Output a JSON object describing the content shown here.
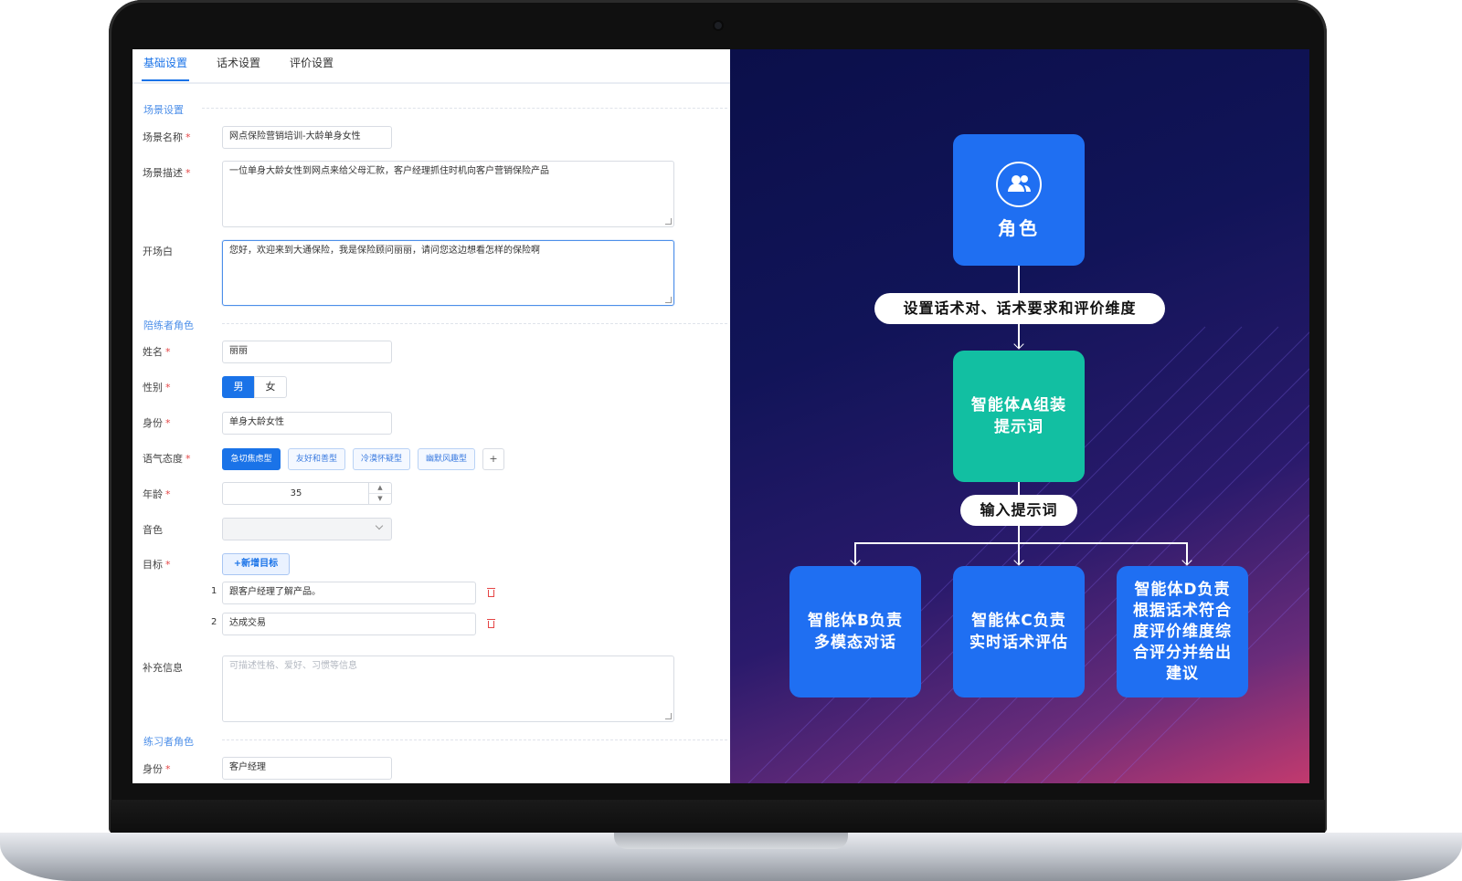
{
  "tabs": [
    {
      "label": "基础设置",
      "active": true
    },
    {
      "label": "话术设置",
      "active": false
    },
    {
      "label": "评价设置",
      "active": false
    }
  ],
  "sections": {
    "scene": "场景设置",
    "partner_role": "陪练者角色",
    "learner_role": "练习者角色"
  },
  "scene": {
    "name_label": "场景名称",
    "name_value": "网点保险营销培训-大龄单身女性",
    "desc_label": "场景描述",
    "desc_value": "一位单身大龄女性到网点来给父母汇款，客户经理抓住时机向客户营销保险产品",
    "opening_label": "开场白",
    "opening_value": "您好，欢迎来到大通保险，我是保险顾问丽丽，请问您这边想看怎样的保险啊"
  },
  "partner": {
    "name_label": "姓名",
    "name_value": "丽丽",
    "gender_label": "性别",
    "gender_options": [
      "男",
      "女"
    ],
    "gender_selected": "男",
    "identity_label": "身份",
    "identity_value": "单身大龄女性",
    "tone_label": "语气态度",
    "tones": [
      {
        "label": "急切焦虑型",
        "selected": true
      },
      {
        "label": "友好和善型",
        "selected": false
      },
      {
        "label": "冷漠怀疑型",
        "selected": false
      },
      {
        "label": "幽默风趣型",
        "selected": false
      }
    ],
    "tone_add": "+",
    "age_label": "年龄",
    "age_value": "35",
    "voice_label": "音色",
    "voice_value": "",
    "goal_label": "目标",
    "add_goal": "+新增目标",
    "goals": [
      {
        "index": "1",
        "text": "跟客户经理了解产品。"
      },
      {
        "index": "2",
        "text": "达成交易"
      }
    ],
    "extra_label": "补充信息",
    "extra_placeholder": "可描述性格、爱好、习惯等信息"
  },
  "learner": {
    "identity_label": "身份",
    "identity_value": "客户经理"
  },
  "required_mark": "*",
  "diagram": {
    "role": "角色",
    "role_icon": "users-icon",
    "step1": "设置话术对、话术要求和评价维度",
    "agent_a": [
      "智能体A组装",
      "提示词"
    ],
    "step2": "输入提示词",
    "agent_b": [
      "智能体B负责",
      "多模态对话"
    ],
    "agent_c": [
      "智能体C负责",
      "实时话术评估"
    ],
    "agent_d": [
      "智能体D负责",
      "根据话术符合",
      "度评价维度综",
      "合评分并给出",
      "建议"
    ]
  },
  "colors": {
    "accent": "#1a73e8",
    "required": "#e54545",
    "node_blue": "#1f6ff2",
    "node_green": "#12bfa2"
  }
}
